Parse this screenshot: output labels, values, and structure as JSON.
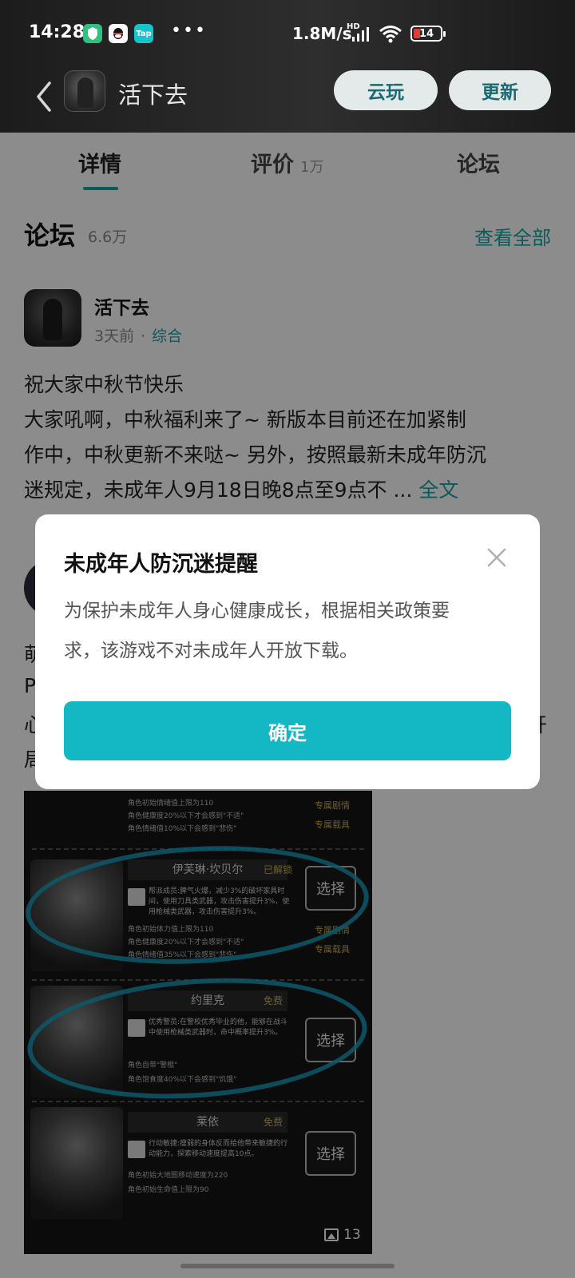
{
  "status_bar": {
    "time": "14:28",
    "app_icons": [
      {
        "icon": "shield-app-icon",
        "color": "#2ec27e"
      },
      {
        "icon": "qq-app-icon",
        "color": "#ffffff"
      },
      {
        "icon": "taptap-app-icon",
        "color": "#15c5ce",
        "label": "Tap"
      }
    ],
    "more": "•••",
    "network_speed": "1.8M/s",
    "hd_label": "HD",
    "battery": "14"
  },
  "header": {
    "title": "活下去",
    "cloud_play_label": "云玩",
    "update_label": "更新"
  },
  "tabs": [
    {
      "label": "详情",
      "count": ""
    },
    {
      "label": "评价",
      "count": "1万"
    },
    {
      "label": "论坛",
      "count": ""
    }
  ],
  "forum": {
    "title": "论坛",
    "count": "6.6万",
    "view_all": "查看全部"
  },
  "post": {
    "author": "活下去",
    "time": "3天前",
    "separator": "·",
    "category": "综合",
    "lines": [
      "祝大家中秋节快乐",
      "大家吼啊，中秋福利来了~ 新版本目前还在加紧制",
      "作中，中秋更新不来哒~ 另外，按照最新未成年防沉",
      "迷规定，未成年人9月18日晚8点至9点不 ..."
    ],
    "more_label": "全文"
  },
  "post2_fragments": {
    "line1": "萌",
    "line2": "P",
    "line3": "心",
    "line3_right": "开",
    "line4": "局"
  },
  "post_image": {
    "rows": [
      {
        "name": "",
        "tag": "",
        "desc": "",
        "stats": [
          "角色初始情绪值上限为110",
          "角色健康度20%以下才会感到\"不适\"",
          "角色情绪值10%以下会感到\"悲伤\""
        ],
        "side": [
          "专属剧情",
          "专属载具"
        ],
        "button": ""
      },
      {
        "name": "伊芙琳·坎贝尔",
        "tag": "已解锁",
        "desc": "帮派成员:脾气火爆，减少3%的破坏家具时间，使用刀具类武器，攻击伤害提升3%，使用枪械类武器，攻击伤害提升3%。",
        "stats": [
          "角色初始体力值上限为110",
          "角色健康度20%以下才会感到\"不适\"",
          "角色情绪值35%以下会感到\"悲伤\""
        ],
        "side": [
          "专属剧情",
          "专属载具"
        ],
        "button": "选择"
      },
      {
        "name": "约里克",
        "tag": "免费",
        "desc": "优秀警员:在警校优秀毕业的他，能够在战斗中使用枪械类武器时，命中概率提升3%。",
        "stats": [
          "角色自带\"警棍\"",
          "角色饱食度40%以下会感到\"饥饿\""
        ],
        "side": [],
        "button": "选择"
      },
      {
        "name": "莱依",
        "tag": "免费",
        "desc": "行动敏捷:瘦弱的身体反而给他带来敏捷的行动能力，探索移动速度提高10点。",
        "stats": [
          "角色初始大地图移动速度为220",
          "角色初始生命值上限为90"
        ],
        "side": [],
        "button": "选择"
      }
    ],
    "image_count": "13"
  },
  "dialog": {
    "title": "未成年人防沉迷提醒",
    "message_line1": "为保护未成年人身心健康成长，根据相关政策要",
    "message_line2": "求，该游戏不对未成年人开放下载。",
    "confirm_label": "确定"
  },
  "colors": {
    "accent": "#14a4a8",
    "confirm_button": "#14b8c4",
    "header_button_bg": "#e4e9ea",
    "header_button_text": "#1b6a72"
  }
}
